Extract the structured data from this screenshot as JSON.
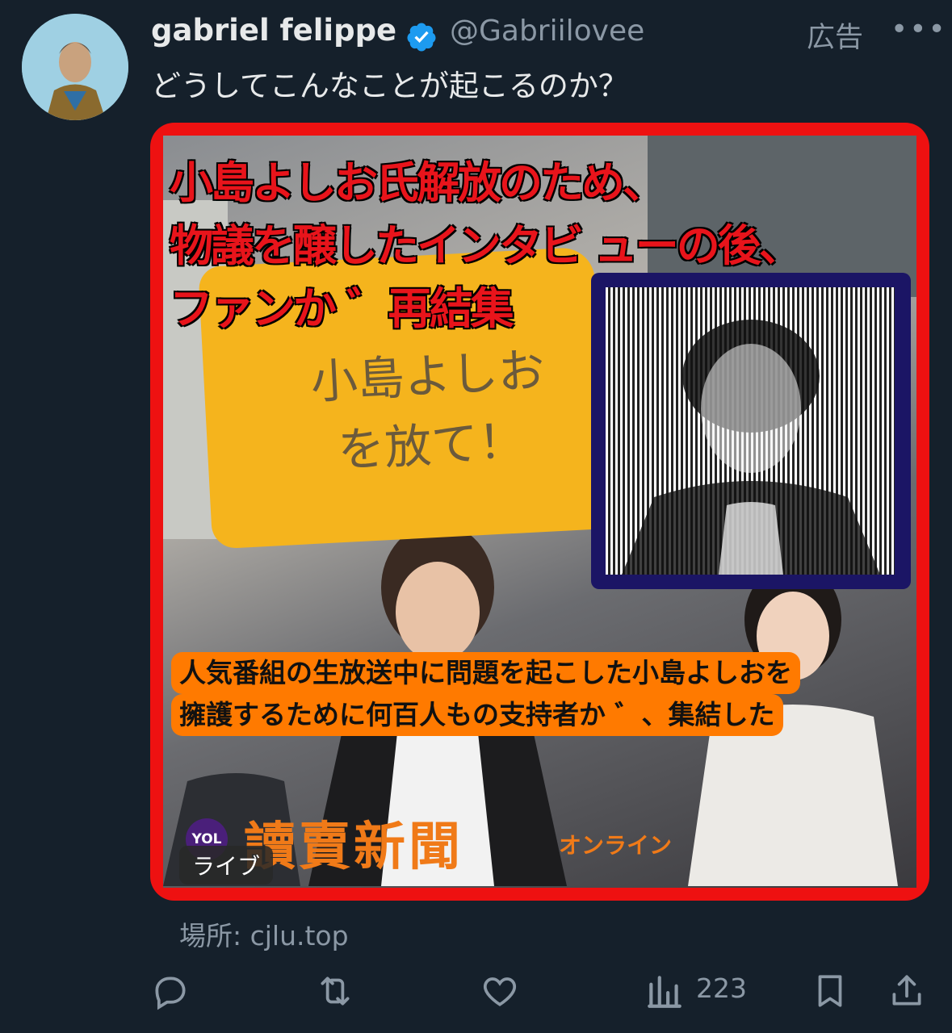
{
  "post": {
    "author_name": "gabriel felippe",
    "author_handle": "@Gabriilovee",
    "ad_label": "広告",
    "more_label": "•••",
    "text": "どうしてこんなことが起こるのか？"
  },
  "media": {
    "headline_lines": [
      "小島よしお氏解放のため、",
      "物議を醸したインタビ ューの後、",
      "ファンか ゛再結集"
    ],
    "sign_lines": [
      "小島よしお",
      "を放て！"
    ],
    "caption_lines": [
      "人気番組の生放送中に問題を起こした小島よしおを",
      "擁護するために何百人もの支持者か ゛、集結した"
    ],
    "logo_badge": "YOL",
    "newspaper_name": "讀賣新聞",
    "newspaper_sub": "オンライン",
    "live_badge": "ライブ"
  },
  "location": "場所: cjlu.top",
  "actions": {
    "views": "223"
  },
  "icons": {
    "verified": "verified-badge-icon",
    "reply": "reply-icon",
    "repost": "repost-icon",
    "like": "like-icon",
    "views": "views-icon",
    "bookmark": "bookmark-icon",
    "share": "share-icon"
  },
  "colors": {
    "background": "#15202b",
    "verified": "#1d9bf0",
    "secondary_text": "#8b98a5",
    "media_frame": "#ee1111"
  }
}
